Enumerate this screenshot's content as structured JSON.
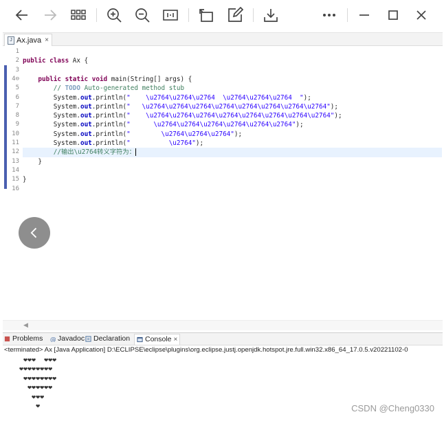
{
  "viewer": {
    "icons": [
      "arrow-left-icon",
      "arrow-right-icon",
      "grid-icon",
      "zoom-in-icon",
      "zoom-out-icon",
      "fit-icon",
      "rotate-icon",
      "edit-icon",
      "download-icon",
      "more-icon",
      "minimize-icon",
      "maximize-icon",
      "close-icon"
    ]
  },
  "editor": {
    "tab_label": "Ax.java",
    "tab_close": "×",
    "file_icon_text": "J",
    "line_numbers": [
      "1",
      "2",
      "3",
      "4⊖",
      "5",
      "6",
      "7",
      "8",
      "9",
      "10",
      "11",
      "12",
      "13",
      "14",
      "15",
      "16"
    ],
    "lines": {
      "l2_kw": "public class",
      "l2_rest": " Ax {",
      "l4_kw": "public static void",
      "l4_rest": " main(String[] args) {",
      "l5_slash": "// ",
      "l5_todo": "TODO",
      "l5_rest": " Auto-generated method stub",
      "print_prefix": "System.",
      "print_field": "out",
      "print_method": ".println(",
      "s6": "\"    \\u2764\\u2764\\u2764  \\u2764\\u2764\\u2764  \"",
      "s7": "\"   \\u2764\\u2764\\u2764\\u2764\\u2764\\u2764\\u2764\\u2764\"",
      "s8": "\"    \\u2764\\u2764\\u2764\\u2764\\u2764\\u2764\\u2764\\u2764\"",
      "s9": "\"      \\u2764\\u2764\\u2764\\u2764\\u2764\\u2764\"",
      "s10": "\"        \\u2764\\u2764\\u2764\"",
      "s11": "\"          \\u2764\"",
      "stmt_end": ");",
      "l12_comment": "//输出\\u2764转义字符为：",
      "close_method": "}",
      "close_class": "}"
    }
  },
  "console": {
    "tabs": [
      {
        "label": "Problems"
      },
      {
        "label": "Javadoc"
      },
      {
        "label": "Declaration"
      },
      {
        "label": "Console",
        "close": "×"
      }
    ],
    "terminated": "<terminated> Ax [Java Application] D:\\ECLIPSE\\eclipse\\plugins\\org.eclipse.justj.openjdk.hotspot.jre.full.win32.x86_64_17.0.5.v20221102-0",
    "output": [
      " ❤❤❤  ❤❤❤",
      "❤❤❤❤❤❤❤❤",
      " ❤❤❤❤❤❤❤❤",
      "  ❤❤❤❤❤❤",
      "   ❤❤❤",
      "    ❤"
    ]
  },
  "watermark": "CSDN @Cheng0330",
  "colors": {
    "keyword": "#7f0055",
    "string": "#2a00ff",
    "comment": "#3f7f5f",
    "field": "#0000c0",
    "change_bar": "#4a5fb0"
  }
}
